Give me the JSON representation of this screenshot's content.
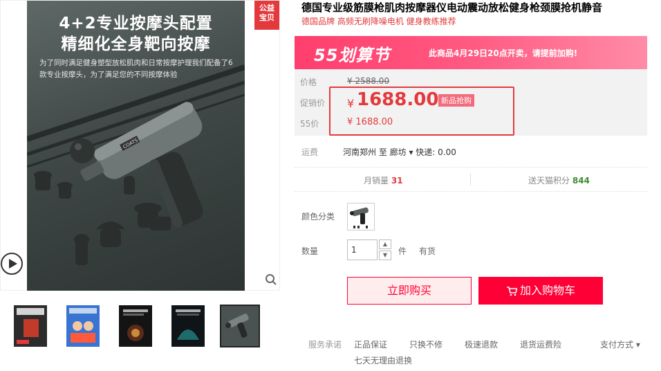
{
  "gallery": {
    "main_headline_1": "4+2专业按摩头配置",
    "main_headline_2": "精细化全身靶向按摩",
    "main_desc": "为了同时满足健身塑型放松肌肉和日常按摩护理我们配备了6款专业按摩头，为了满足您的不同按摩体验",
    "badge_line1": "公益",
    "badge_line2": "宝贝",
    "device_brand": "COATS",
    "thumb_icon_names": [
      "product-thumb-1",
      "product-thumb-2",
      "product-thumb-3",
      "product-thumb-4",
      "product-thumb-5"
    ]
  },
  "product": {
    "title": "德国专业级筋膜枪肌肉按摩器仪电动震动放松健身枪颈膜抢机静音",
    "subtitle": "德国品牌 高频无刷降噪电机 健身教练推荐"
  },
  "promo": {
    "logo": "55划算节",
    "text": "此商品4月29日20点开卖，请提前加购!"
  },
  "price": {
    "label_price": "价格",
    "original": "¥ 2588.00",
    "label_promo": "促销价",
    "currency": "¥",
    "promo_value": "1688.00",
    "new_tag": "新品抢购",
    "label_55": "55价",
    "price_55": "¥ 1688.00"
  },
  "shipping": {
    "label": "运费",
    "value": "河南郑州  至  廊坊 ▾  快递: 0.00"
  },
  "stats": {
    "monthly_label": "月销量",
    "monthly_value": "31",
    "points_label": "送天猫积分",
    "points_value": "844"
  },
  "options": {
    "color_label": "颜色分类",
    "qty_label": "数量",
    "qty_value": "1",
    "unit": "件",
    "stock": "有货"
  },
  "actions": {
    "buy": "立即购买",
    "cart": "加入购物车"
  },
  "service": {
    "label": "服务承诺",
    "items": [
      "正品保证",
      "极速退款",
      "退货运费险"
    ],
    "item_swap": "只换不修",
    "item_7day": "七天无理由退换",
    "payment": "支付方式 ▾"
  },
  "colors": {
    "accent": "#ff0036",
    "price_red": "#e4393c",
    "promo_pink": "#ff4a77",
    "points_green": "#3c8d2f"
  }
}
